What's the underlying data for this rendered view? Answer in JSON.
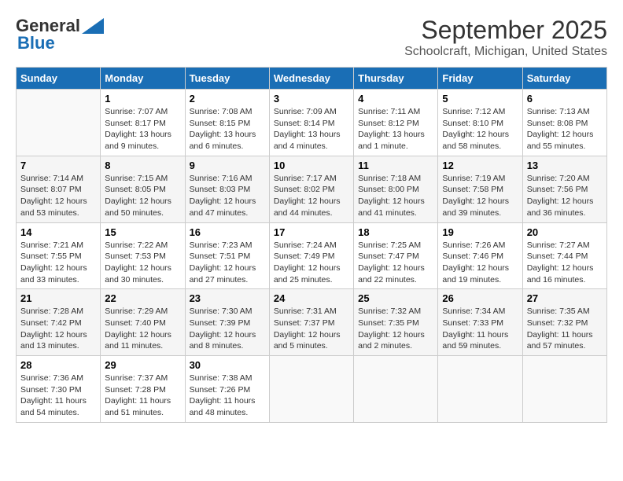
{
  "header": {
    "logo_general": "General",
    "logo_blue": "Blue",
    "title": "September 2025",
    "subtitle": "Schoolcraft, Michigan, United States"
  },
  "columns": [
    "Sunday",
    "Monday",
    "Tuesday",
    "Wednesday",
    "Thursday",
    "Friday",
    "Saturday"
  ],
  "weeks": [
    [
      {
        "day": "",
        "info": ""
      },
      {
        "day": "1",
        "info": "Sunrise: 7:07 AM\nSunset: 8:17 PM\nDaylight: 13 hours\nand 9 minutes."
      },
      {
        "day": "2",
        "info": "Sunrise: 7:08 AM\nSunset: 8:15 PM\nDaylight: 13 hours\nand 6 minutes."
      },
      {
        "day": "3",
        "info": "Sunrise: 7:09 AM\nSunset: 8:14 PM\nDaylight: 13 hours\nand 4 minutes."
      },
      {
        "day": "4",
        "info": "Sunrise: 7:11 AM\nSunset: 8:12 PM\nDaylight: 13 hours\nand 1 minute."
      },
      {
        "day": "5",
        "info": "Sunrise: 7:12 AM\nSunset: 8:10 PM\nDaylight: 12 hours\nand 58 minutes."
      },
      {
        "day": "6",
        "info": "Sunrise: 7:13 AM\nSunset: 8:08 PM\nDaylight: 12 hours\nand 55 minutes."
      }
    ],
    [
      {
        "day": "7",
        "info": "Sunrise: 7:14 AM\nSunset: 8:07 PM\nDaylight: 12 hours\nand 53 minutes."
      },
      {
        "day": "8",
        "info": "Sunrise: 7:15 AM\nSunset: 8:05 PM\nDaylight: 12 hours\nand 50 minutes."
      },
      {
        "day": "9",
        "info": "Sunrise: 7:16 AM\nSunset: 8:03 PM\nDaylight: 12 hours\nand 47 minutes."
      },
      {
        "day": "10",
        "info": "Sunrise: 7:17 AM\nSunset: 8:02 PM\nDaylight: 12 hours\nand 44 minutes."
      },
      {
        "day": "11",
        "info": "Sunrise: 7:18 AM\nSunset: 8:00 PM\nDaylight: 12 hours\nand 41 minutes."
      },
      {
        "day": "12",
        "info": "Sunrise: 7:19 AM\nSunset: 7:58 PM\nDaylight: 12 hours\nand 39 minutes."
      },
      {
        "day": "13",
        "info": "Sunrise: 7:20 AM\nSunset: 7:56 PM\nDaylight: 12 hours\nand 36 minutes."
      }
    ],
    [
      {
        "day": "14",
        "info": "Sunrise: 7:21 AM\nSunset: 7:55 PM\nDaylight: 12 hours\nand 33 minutes."
      },
      {
        "day": "15",
        "info": "Sunrise: 7:22 AM\nSunset: 7:53 PM\nDaylight: 12 hours\nand 30 minutes."
      },
      {
        "day": "16",
        "info": "Sunrise: 7:23 AM\nSunset: 7:51 PM\nDaylight: 12 hours\nand 27 minutes."
      },
      {
        "day": "17",
        "info": "Sunrise: 7:24 AM\nSunset: 7:49 PM\nDaylight: 12 hours\nand 25 minutes."
      },
      {
        "day": "18",
        "info": "Sunrise: 7:25 AM\nSunset: 7:47 PM\nDaylight: 12 hours\nand 22 minutes."
      },
      {
        "day": "19",
        "info": "Sunrise: 7:26 AM\nSunset: 7:46 PM\nDaylight: 12 hours\nand 19 minutes."
      },
      {
        "day": "20",
        "info": "Sunrise: 7:27 AM\nSunset: 7:44 PM\nDaylight: 12 hours\nand 16 minutes."
      }
    ],
    [
      {
        "day": "21",
        "info": "Sunrise: 7:28 AM\nSunset: 7:42 PM\nDaylight: 12 hours\nand 13 minutes."
      },
      {
        "day": "22",
        "info": "Sunrise: 7:29 AM\nSunset: 7:40 PM\nDaylight: 12 hours\nand 11 minutes."
      },
      {
        "day": "23",
        "info": "Sunrise: 7:30 AM\nSunset: 7:39 PM\nDaylight: 12 hours\nand 8 minutes."
      },
      {
        "day": "24",
        "info": "Sunrise: 7:31 AM\nSunset: 7:37 PM\nDaylight: 12 hours\nand 5 minutes."
      },
      {
        "day": "25",
        "info": "Sunrise: 7:32 AM\nSunset: 7:35 PM\nDaylight: 12 hours\nand 2 minutes."
      },
      {
        "day": "26",
        "info": "Sunrise: 7:34 AM\nSunset: 7:33 PM\nDaylight: 11 hours\nand 59 minutes."
      },
      {
        "day": "27",
        "info": "Sunrise: 7:35 AM\nSunset: 7:32 PM\nDaylight: 11 hours\nand 57 minutes."
      }
    ],
    [
      {
        "day": "28",
        "info": "Sunrise: 7:36 AM\nSunset: 7:30 PM\nDaylight: 11 hours\nand 54 minutes."
      },
      {
        "day": "29",
        "info": "Sunrise: 7:37 AM\nSunset: 7:28 PM\nDaylight: 11 hours\nand 51 minutes."
      },
      {
        "day": "30",
        "info": "Sunrise: 7:38 AM\nSunset: 7:26 PM\nDaylight: 11 hours\nand 48 minutes."
      },
      {
        "day": "",
        "info": ""
      },
      {
        "day": "",
        "info": ""
      },
      {
        "day": "",
        "info": ""
      },
      {
        "day": "",
        "info": ""
      }
    ]
  ]
}
